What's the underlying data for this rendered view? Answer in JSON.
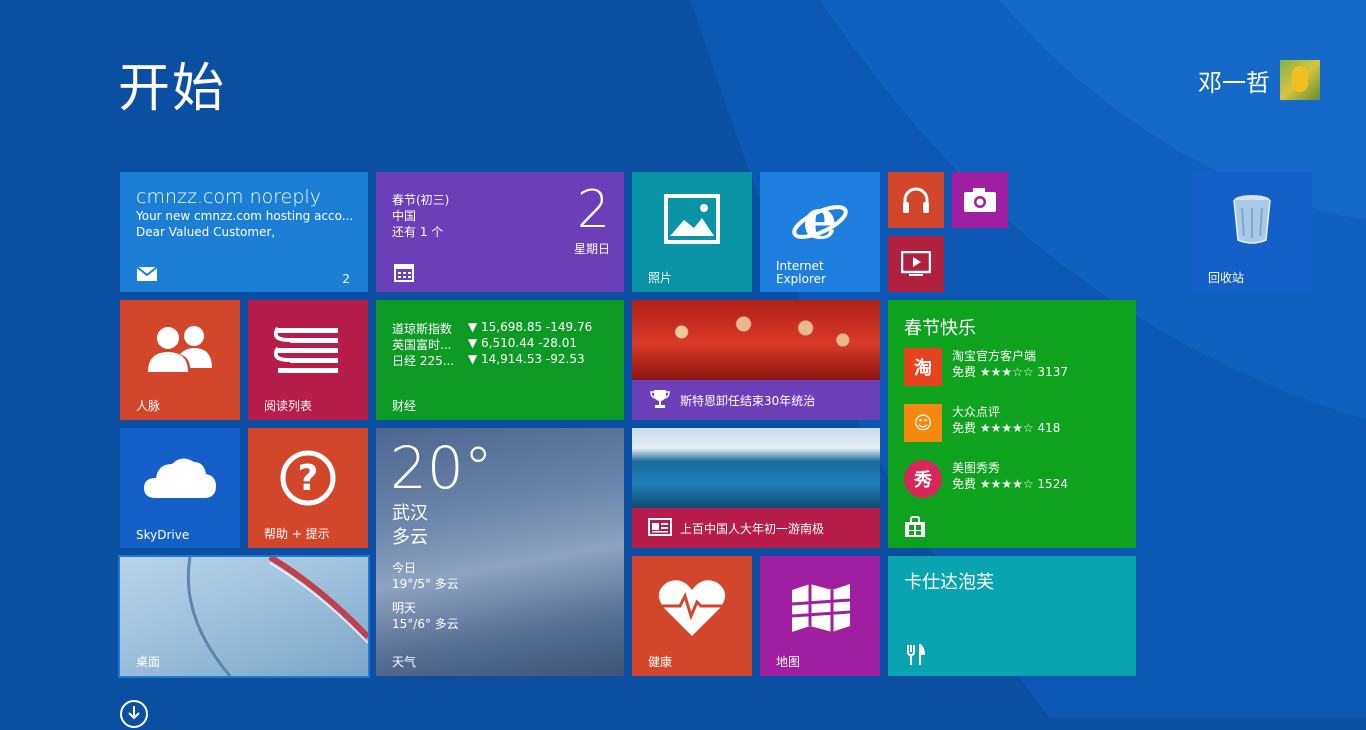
{
  "start": {
    "title": "开始"
  },
  "user": {
    "name": "邓一哲"
  },
  "tiles": {
    "mail": {
      "header": "cmnzz.com noreply",
      "line1": "Your new cmnzz.com hosting acco...",
      "line2": "Dear Valued Customer,",
      "count": "2",
      "icon": "mail-icon"
    },
    "calendar": {
      "line1": "春节(初三)",
      "line2": "中国",
      "line3": "还有 1 个",
      "date": "2",
      "weekday": "星期日",
      "icon": "calendar-icon"
    },
    "photos": {
      "label": "照片",
      "icon": "photo-icon"
    },
    "ie": {
      "label1": "Internet",
      "label2": "Explorer",
      "icon": "ie-icon"
    },
    "music": {
      "icon": "headphones-icon"
    },
    "camera": {
      "icon": "camera-icon"
    },
    "video": {
      "icon": "video-icon"
    },
    "recycle": {
      "label": "回收站",
      "icon": "recycle-bin-icon"
    },
    "people": {
      "label": "人脉",
      "icon": "people-icon"
    },
    "reading": {
      "label": "阅读列表",
      "icon": "reading-list-icon"
    },
    "finance": {
      "label": "财经",
      "rows": [
        {
          "name": "道琼斯指数",
          "value": "▼ 15,698.85 -149.76"
        },
        {
          "name": "英国富时...",
          "value": "▼ 6,510.44 -28.01"
        },
        {
          "name": "日经 225...",
          "value": "▼ 14,914.53 -92.53"
        }
      ]
    },
    "sports": {
      "caption": "斯特恩卸任结束30年统治",
      "icon": "trophy-icon"
    },
    "store": {
      "header": "春节快乐",
      "apps": [
        {
          "name": "淘宝官方客户端",
          "meta": "免费 ★★★☆☆ 3137",
          "glyph": "淘",
          "color": "#e8431f"
        },
        {
          "name": "大众点评",
          "meta": "免费 ★★★★☆ 418",
          "glyph": "☺",
          "color": "#f5880f"
        },
        {
          "name": "美图秀秀",
          "meta": "免费 ★★★★☆ 1524",
          "glyph": "秀",
          "color": "#d7265a"
        }
      ],
      "icon": "store-icon"
    },
    "skydrive": {
      "label": "SkyDrive",
      "icon": "cloud-icon"
    },
    "help": {
      "label": "帮助 + 提示",
      "icon": "help-icon"
    },
    "weather": {
      "temp": "20°",
      "city": "武汉",
      "condition": "多云",
      "today_label": "今日",
      "today": "19°/5° 多云",
      "tomorrow_label": "明天",
      "tomorrow": "15°/6° 多云",
      "label": "天气"
    },
    "news": {
      "caption": "上百中国人大年初一游南极",
      "icon": "news-icon"
    },
    "desktop": {
      "label": "桌面"
    },
    "health": {
      "label": "健康",
      "icon": "heart-icon"
    },
    "maps": {
      "label": "地图",
      "icon": "map-icon"
    },
    "food": {
      "header": "卡仕达泡芙",
      "icon": "food-icon"
    }
  },
  "apps_view": {
    "icon": "down-arrow-icon"
  }
}
